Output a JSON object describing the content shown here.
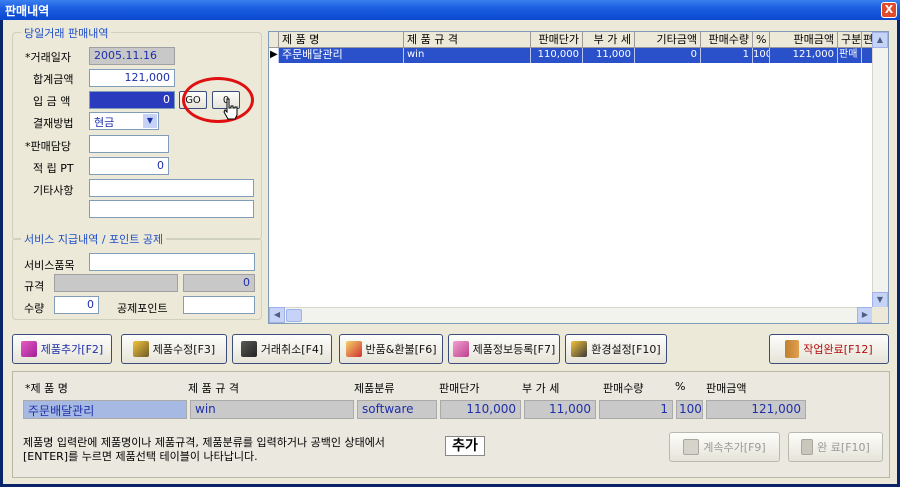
{
  "window": {
    "title": "판매내역",
    "close_glyph": "X"
  },
  "sales_group": {
    "title": "당일거래 판매내역",
    "fields": {
      "date_label": "*거래일자",
      "date_value": "2005.11.16",
      "total_label": "합계금액",
      "total_value": "121,000",
      "paid_label": "입 금 액",
      "paid_value": "0",
      "go_button": "GO",
      "zero_button": "0",
      "payment_label": "결재방법",
      "payment_value": "현금",
      "staff_label": "*판매담당",
      "staff_value": "",
      "points_label": "적 립 PT",
      "points_value": "0",
      "misc_label": "기타사항",
      "misc_value": "",
      "misc_value2": ""
    }
  },
  "service_group": {
    "title": "서비스 지급내역 / 포인트 공제",
    "item_label": "서비스품목",
    "item_value": "",
    "spec_label": "규격",
    "spec_value": "",
    "spec_amount": "0",
    "qty_label": "수량",
    "qty_value": "0",
    "deduct_label": "공제포인트",
    "deduct_value": ""
  },
  "grid": {
    "columns": [
      "제  품  명",
      "제  품  규  격",
      "판매단가",
      "부 가 세",
      "기타금액",
      "판매수량",
      "%",
      "판매금액",
      "구분",
      "편"
    ],
    "rows": [
      {
        "indicator": "▶",
        "name": "주문배달관리",
        "spec": "win",
        "price": "110,000",
        "vat": "11,000",
        "other": "0",
        "qty": "1",
        "pct": "100",
        "amount": "121,000",
        "type": "판매",
        "extra": ""
      }
    ]
  },
  "toolbar": {
    "add": "제품추가[F2]",
    "edit": "제품수정[F3]",
    "cancel": "거래취소[F4]",
    "return": "반품&환불[F6]",
    "register": "제품정보등록[F7]",
    "settings": "환경설정[F10]",
    "finish": "작업완료[F12]"
  },
  "entry": {
    "headers": [
      "*제  품  명",
      "제 품 규 격",
      "제품분류",
      "판매단가",
      "부 가 세",
      "판매수량",
      "%",
      "판매금액"
    ],
    "values": {
      "name": "주문배달관리",
      "spec": "win",
      "category": "software",
      "price": "110,000",
      "vat": "11,000",
      "qty": "1",
      "pct": "100",
      "amount": "121,000"
    },
    "hint_line1": "제품명 입력란에 제품명이나 제품규격, 제품분류를 입력하거나 공백인 상태에서",
    "hint_line2": "[ENTER]를 누르면 제품선택 테이블이 나타납니다.",
    "add_label": "추가",
    "continue_button": "계속추가[F9]",
    "done_button": "완 료[F10]"
  },
  "colors": {
    "accent": "#1f4fc9",
    "selection": "#2a51c9",
    "highlight_circle": "#e01010"
  }
}
